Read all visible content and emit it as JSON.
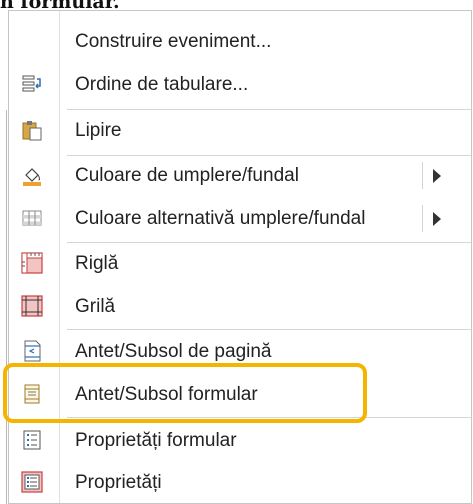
{
  "header_fragment": "n formular.",
  "menu": {
    "items": [
      {
        "label": "Construire eveniment...",
        "icon": null
      },
      {
        "label": "Ordine de tabulare...",
        "icon": "tab-order-icon"
      },
      {
        "label": "Lipire",
        "icon": "paste-icon"
      },
      {
        "label": "Culoare de umplere/fundal",
        "icon": "fill-color-icon",
        "submenu": true
      },
      {
        "label": "Culoare alternativă umplere/fundal",
        "icon": "alternate-fill-icon",
        "submenu": true
      },
      {
        "label": "Riglă",
        "icon": "ruler-icon"
      },
      {
        "label": "Grilă",
        "icon": "grid-icon"
      },
      {
        "label": "Antet/Subsol de pagină",
        "icon": "page-header-footer-icon"
      },
      {
        "label": "Antet/Subsol formular",
        "icon": "form-header-footer-icon",
        "highlighted": true
      },
      {
        "label": "Proprietăți formular",
        "icon": "form-properties-icon"
      },
      {
        "label": "Proprietăți",
        "icon": "properties-icon"
      }
    ]
  },
  "colors": {
    "highlight_border": "#f5b400",
    "fill_icon_orange": "#f0a030",
    "ruler_red": "#e06060"
  }
}
